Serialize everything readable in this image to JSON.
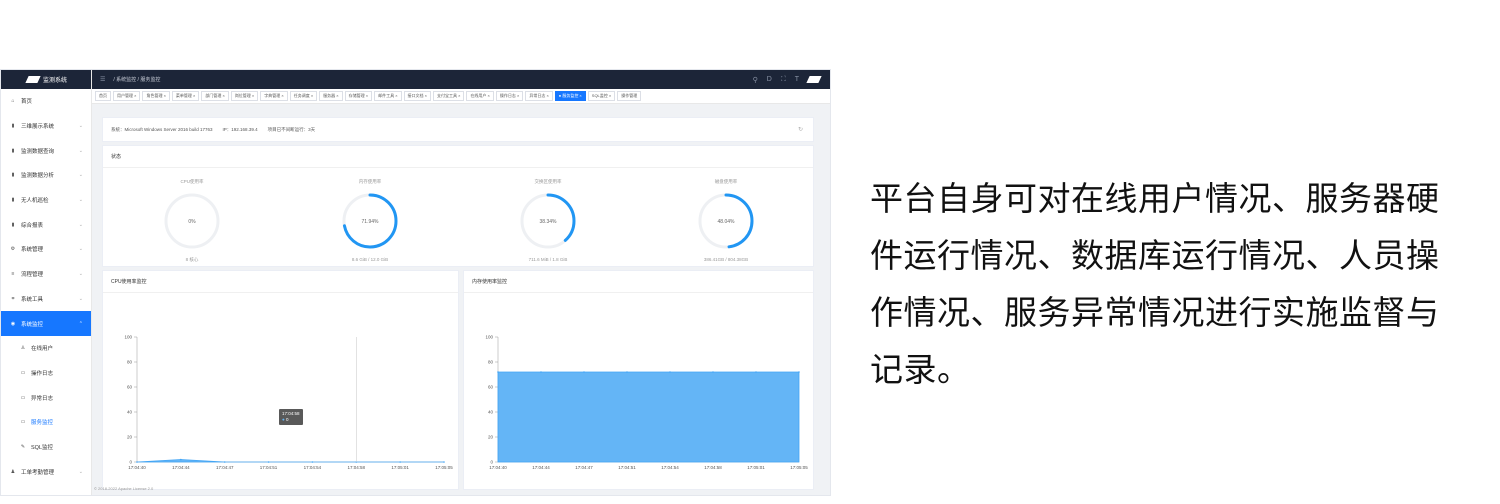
{
  "sidebar": {
    "logo_text": "监测系统",
    "items": [
      {
        "icon": "home-icon",
        "glyph": "⌂",
        "label": "首页",
        "chevron": ""
      },
      {
        "icon": "bar-chart-icon",
        "glyph": "▮",
        "label": "三维展示系统",
        "chevron": "⌄"
      },
      {
        "icon": "bar-chart-icon",
        "glyph": "▮",
        "label": "监测数据查询",
        "chevron": "⌄"
      },
      {
        "icon": "bar-chart-icon",
        "glyph": "▮",
        "label": "监测数据分析",
        "chevron": "⌄"
      },
      {
        "icon": "bar-chart-icon",
        "glyph": "▮",
        "label": "无人机巡检",
        "chevron": "⌄"
      },
      {
        "icon": "bar-chart-icon",
        "glyph": "▮",
        "label": "综合报表",
        "chevron": "⌄"
      },
      {
        "icon": "gear-icon",
        "glyph": "⚙",
        "label": "系统管理",
        "chevron": "⌄"
      },
      {
        "icon": "list-icon",
        "glyph": "≡",
        "label": "流程管理",
        "chevron": "⌄"
      },
      {
        "icon": "tool-icon",
        "glyph": "⌗",
        "label": "系统工具",
        "chevron": "⌄"
      },
      {
        "icon": "monitor-icon",
        "glyph": "◉",
        "label": "系统监控",
        "chevron": "⌃",
        "active": true
      },
      {
        "icon": "user-icon",
        "glyph": "♙",
        "label": "在线用户",
        "sub": true
      },
      {
        "icon": "log-icon",
        "glyph": "▭",
        "label": "操作日志",
        "sub": true
      },
      {
        "icon": "log-icon",
        "glyph": "▭",
        "label": "异常日志",
        "sub": true
      },
      {
        "icon": "server-icon",
        "glyph": "▭",
        "label": "服务监控",
        "sub": true,
        "current": true
      },
      {
        "icon": "sql-icon",
        "glyph": "✎",
        "label": "SQL监控",
        "sub": true
      },
      {
        "icon": "attendance-icon",
        "glyph": "♟",
        "label": "工单考勤管理",
        "chevron": "⌄"
      }
    ]
  },
  "topbar": {
    "breadcrumb": "/ 系统监控 / 服务监控",
    "tools": [
      "⚲",
      "D",
      "⛶",
      "T"
    ]
  },
  "tabs": [
    "首页",
    "用户管理 ×",
    "角色管理 ×",
    "菜单管理 ×",
    "部门管理 ×",
    "岗位管理 ×",
    "字典管理 ×",
    "任务调度 ×",
    "服务器 ×",
    "存储管理 ×",
    "邮件工具 ×",
    "接口文档 ×",
    "支付宝工具 ×",
    "在线用户 ×",
    "操作日志 ×",
    "异常日志 ×",
    "● 服务监控 ×",
    "SQL监控 ×",
    "操作管理"
  ],
  "active_tab_index": 16,
  "sysinfo": {
    "system": "系统：Microsoft Windows Server 2016 build 17763",
    "ip": "IP：192.168.39.4",
    "uptime": "项目已不间断运行：3天"
  },
  "status": {
    "title": "状态",
    "gauges": [
      {
        "label": "CPU使用率",
        "value": "0%",
        "percent": 0,
        "detail": "8 核心"
      },
      {
        "label": "内存使用率",
        "value": "71.94%",
        "percent": 71.94,
        "detail": "8.6 GiB / 12.0 GiB"
      },
      {
        "label": "交换区使用率",
        "value": "38.34%",
        "percent": 38.34,
        "detail": "711.6 MiB / 1.8 GiB"
      },
      {
        "label": "磁盘使用率",
        "value": "48.04%",
        "percent": 48.04,
        "detail": "386.41GB / 804.38GB"
      }
    ]
  },
  "footer": "© 2018-2022 Apache License 2.0",
  "description": "平台自身可对在线用户情况、服务器硬件运行情况、数据库运行情况、人员操作情况、服务异常情况进行实施监督与记录。",
  "colors": {
    "accent": "#1677ff",
    "header": "#1c2538",
    "gauge": "#2196f3",
    "area_fill": "#64b5f6"
  },
  "chart_data": [
    {
      "type": "area",
      "title": "CPU使用率监控",
      "x": [
        "17:04:40",
        "17:04:44",
        "17:04:47",
        "17:04:51",
        "17:04:54",
        "17:04:58",
        "17:05:01",
        "17:05:05"
      ],
      "series": [
        {
          "values": [
            0,
            2,
            0,
            0,
            0,
            0,
            0,
            0
          ]
        }
      ],
      "yticks": [
        0,
        20,
        40,
        60,
        80,
        100
      ],
      "ylim": [
        0,
        100
      ],
      "tooltip": {
        "time": "17:04:58",
        "value": "0"
      }
    },
    {
      "type": "area",
      "title": "内存使用率监控",
      "x": [
        "17:04:40",
        "17:04:44",
        "17:04:47",
        "17:04:51",
        "17:04:54",
        "17:04:58",
        "17:05:01",
        "17:05:05"
      ],
      "series": [
        {
          "values": [
            72,
            72,
            72,
            72,
            72,
            72,
            72,
            72
          ]
        }
      ],
      "yticks": [
        0,
        20,
        40,
        60,
        80,
        100
      ],
      "ylim": [
        0,
        100
      ]
    }
  ]
}
